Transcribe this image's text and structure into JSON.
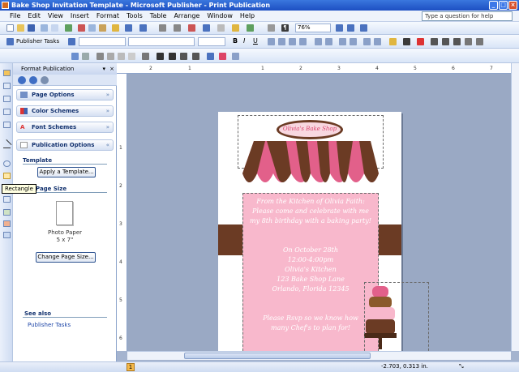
{
  "window": {
    "title": "Bake Shop Invitation Template - Microsoft Publisher - Print Publication"
  },
  "menu": [
    "File",
    "Edit",
    "View",
    "Insert",
    "Format",
    "Tools",
    "Table",
    "Arrange",
    "Window",
    "Help"
  ],
  "help_box": {
    "placeholder": "Type a question for help"
  },
  "toolbar": {
    "zoom": "76%",
    "tasks_label": "Publisher Tasks"
  },
  "task_pane": {
    "title": "Format Publication",
    "sections": [
      "Page Options",
      "Color Schemes",
      "Font Schemes",
      "Publication Options"
    ],
    "template_label": "Template",
    "apply_button": "Apply a Template...",
    "page_size_label": "Page Size",
    "paper_name": "Photo Paper",
    "paper_size": "5 x 7\"",
    "change_button": "Change Page Size...",
    "see_also": "See also",
    "link": "Publisher Tasks"
  },
  "tooltip": "Rectangle",
  "ruler_top": [
    "2",
    "1",
    "1",
    "2",
    "3",
    "4",
    "5",
    "6",
    "7"
  ],
  "ruler_left": [
    "1",
    "2",
    "3",
    "4",
    "5",
    "6"
  ],
  "status": {
    "page": "1",
    "position": "-2.703, 0.313 in."
  },
  "invitation": {
    "shop_name": "Olivia's Bake Shop",
    "lines": [
      "From the Kitchen of Olivia Faith:",
      "Please come and celebrate with me",
      "my 8th birthday with a baking party!",
      "",
      "On October 28th",
      "12:00-4:00pm",
      "Olivia's Kitchen",
      "123 Bake Shop Lane",
      "Orlando, Florida 12345",
      "",
      "Please Rsvp so we know how",
      "many Chef's to plan for!"
    ]
  },
  "colors": {
    "pink": "#f8b8cc",
    "brown": "#6b3b24",
    "accent": "#e2608a"
  }
}
